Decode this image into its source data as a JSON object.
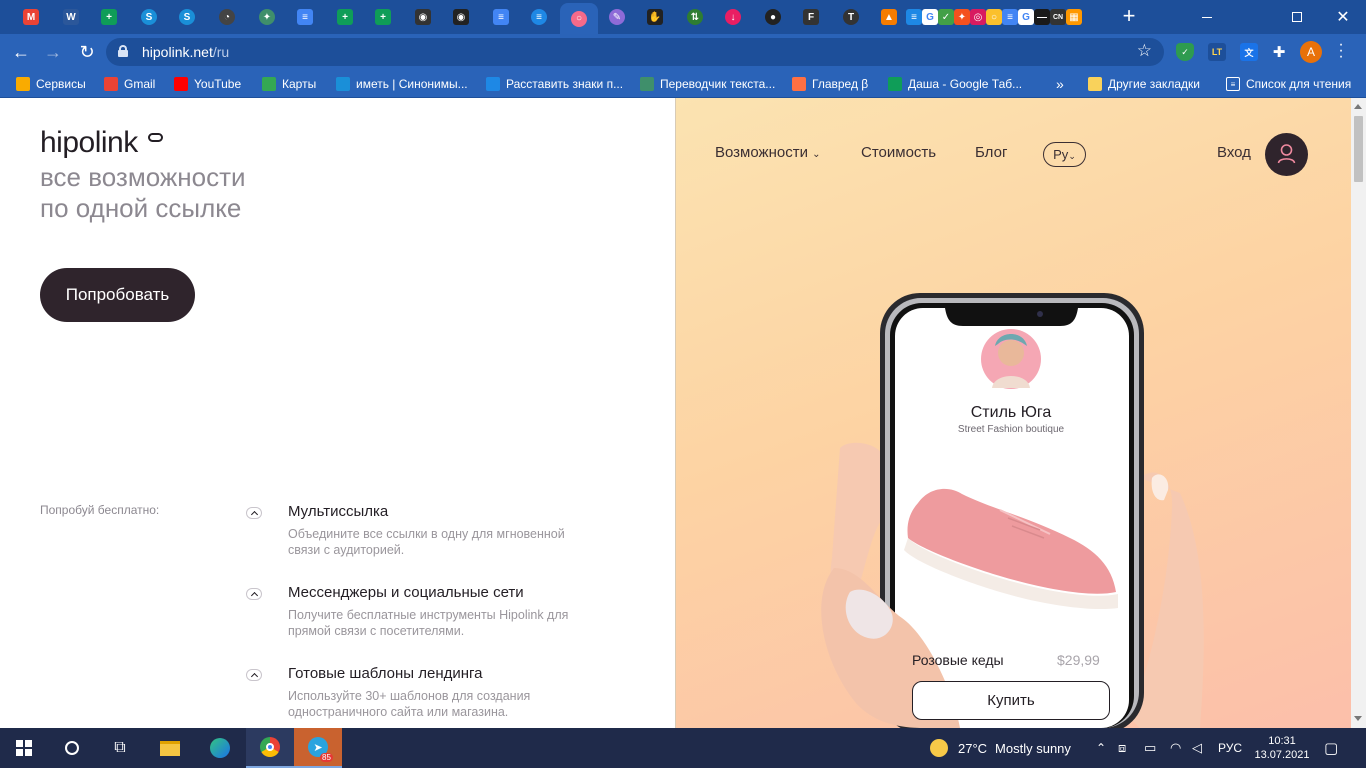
{
  "browser": {
    "url_host": "hipolink.net",
    "url_path": "/ru",
    "profile_initial": "A",
    "tabs": [
      {
        "icon": "gmail-icon",
        "glyph": "M",
        "color": "#ea4335"
      },
      {
        "icon": "word-icon",
        "glyph": "W",
        "color": "#2b579a"
      },
      {
        "icon": "sheets-icon",
        "glyph": "+",
        "color": "#0f9d58"
      },
      {
        "icon": "synonym-icon",
        "glyph": "S",
        "color": "#1a8fd8"
      },
      {
        "icon": "synonym-icon",
        "glyph": "S",
        "color": "#1a8fd8"
      },
      {
        "icon": "circle-icon",
        "glyph": "◔",
        "color": "#444"
      },
      {
        "icon": "translator-icon",
        "glyph": "✦",
        "color": "#3f8f6b"
      },
      {
        "icon": "docs-icon",
        "glyph": "≡",
        "color": "#4285f4"
      },
      {
        "icon": "sheets-icon",
        "glyph": "+",
        "color": "#0f9d58"
      },
      {
        "icon": "sheets-icon",
        "glyph": "+",
        "color": "#0f9d58"
      },
      {
        "icon": "eye-icon",
        "glyph": "◉",
        "color": "#333"
      },
      {
        "icon": "eye-icon",
        "glyph": "◉",
        "color": "#222"
      },
      {
        "icon": "docs-icon",
        "glyph": "≡",
        "color": "#4285f4"
      },
      {
        "icon": "list-icon",
        "glyph": "≡",
        "color": "#1e88e5"
      },
      {
        "icon": "hipolink-icon",
        "glyph": "○",
        "color": "#f46a8a"
      },
      {
        "icon": "link-icon",
        "glyph": "✎",
        "color": "#8e6bd8"
      },
      {
        "icon": "hand-icon",
        "glyph": "✋",
        "color": "#222"
      },
      {
        "icon": "arrows-icon",
        "glyph": "⇅",
        "color": "#2e7d32"
      },
      {
        "icon": "arrow-down-icon",
        "glyph": "↓",
        "color": "#e91e63"
      },
      {
        "icon": "chat-icon",
        "glyph": "●",
        "color": "#222"
      },
      {
        "icon": "text-icon",
        "glyph": "F",
        "color": "#333"
      },
      {
        "icon": "tp-icon",
        "glyph": "T",
        "color": "#333"
      },
      {
        "icon": "triangle-icon",
        "glyph": "▲",
        "color": "#f57c00"
      }
    ],
    "pinned_icons": [
      {
        "icon": "list-icon",
        "glyph": "≡",
        "color": "#1e88e5"
      },
      {
        "icon": "google-icon",
        "glyph": "G",
        "color": "#ffffff"
      },
      {
        "icon": "leaf-icon",
        "glyph": "✓",
        "color": "#43a047"
      },
      {
        "icon": "puzzle-icon",
        "glyph": "✦",
        "color": "#f4511e"
      },
      {
        "icon": "instagram-icon",
        "glyph": "◎",
        "color": "#d81b60"
      },
      {
        "icon": "ring-icon",
        "glyph": "○",
        "color": "#fbc02d"
      },
      {
        "icon": "docs-icon",
        "glyph": "≡",
        "color": "#4285f4"
      },
      {
        "icon": "google-icon",
        "glyph": "G",
        "color": "#ffffff"
      },
      {
        "icon": "dash-icon",
        "glyph": "—",
        "color": "#1a1a1a"
      },
      {
        "icon": "cn-icon",
        "glyph": "CN",
        "color": "#333"
      },
      {
        "icon": "windows-icon",
        "glyph": "▦",
        "color": "#ff9800"
      }
    ],
    "bookmarks": [
      {
        "label": "Сервисы",
        "icon": "apps-grid-icon",
        "color": "#f9ab00"
      },
      {
        "label": "Gmail",
        "icon": "gmail-icon",
        "color": "#ea4335"
      },
      {
        "label": "YouTube",
        "icon": "youtube-icon",
        "color": "#ff0000"
      },
      {
        "label": "Карты",
        "icon": "maps-pin-icon",
        "color": "#34a853"
      },
      {
        "label": "иметь | Синонимы...",
        "icon": "synonym-icon",
        "color": "#1a8fd8"
      },
      {
        "label": "Расставить знаки п...",
        "icon": "text-t-icon",
        "color": "#1e88e5"
      },
      {
        "label": "Переводчик текста...",
        "icon": "translator-icon",
        "color": "#3f8f6b"
      },
      {
        "label": "Главред β",
        "icon": "glavred-icon",
        "color": "#ff7043"
      },
      {
        "label": "Даша - Google Таб...",
        "icon": "sheets-icon",
        "color": "#0f9d58"
      }
    ],
    "other_bookmarks": "Другие закладки",
    "reading_list": "Список для чтения"
  },
  "page": {
    "logo": "hipolink",
    "tagline_line1": "все возможности",
    "tagline_line2": "по одной ссылке",
    "cta": "Попробовать",
    "free_label": "Попробуй бесплатно:",
    "features": [
      {
        "title": "Мультиссылка",
        "desc": "Объедините все ссылки в одну для мгновенной связи с аудиторией."
      },
      {
        "title": "Мессенджеры и социальные сети",
        "desc": "Получите бесплатные инструменты Hipolink для прямой связи с посетителями."
      },
      {
        "title": "Готовые шаблоны лендинга",
        "desc": "Используйте 30+ шаблонов для создания одностраничного сайта или магазина."
      }
    ],
    "nav": {
      "features": "Возможности",
      "pricing": "Стоимость",
      "blog": "Блог",
      "lang": "Ру",
      "login": "Вход"
    },
    "phone": {
      "shop_name": "Стиль Юга",
      "shop_subtitle": "Street Fashion boutique",
      "product_name": "Розовые кеды",
      "product_price": "$29,99",
      "buy": "Купить"
    },
    "colors": {
      "dark": "#2f242c",
      "gradient_top": "#fbe3b1",
      "gradient_bottom": "#fcbfaa"
    }
  },
  "taskbar": {
    "weather_temp": "27°C",
    "weather_text": "Mostly sunny",
    "lang": "РУС",
    "time": "10:31",
    "date": "13.07.2021",
    "telegram_badge": "85"
  }
}
